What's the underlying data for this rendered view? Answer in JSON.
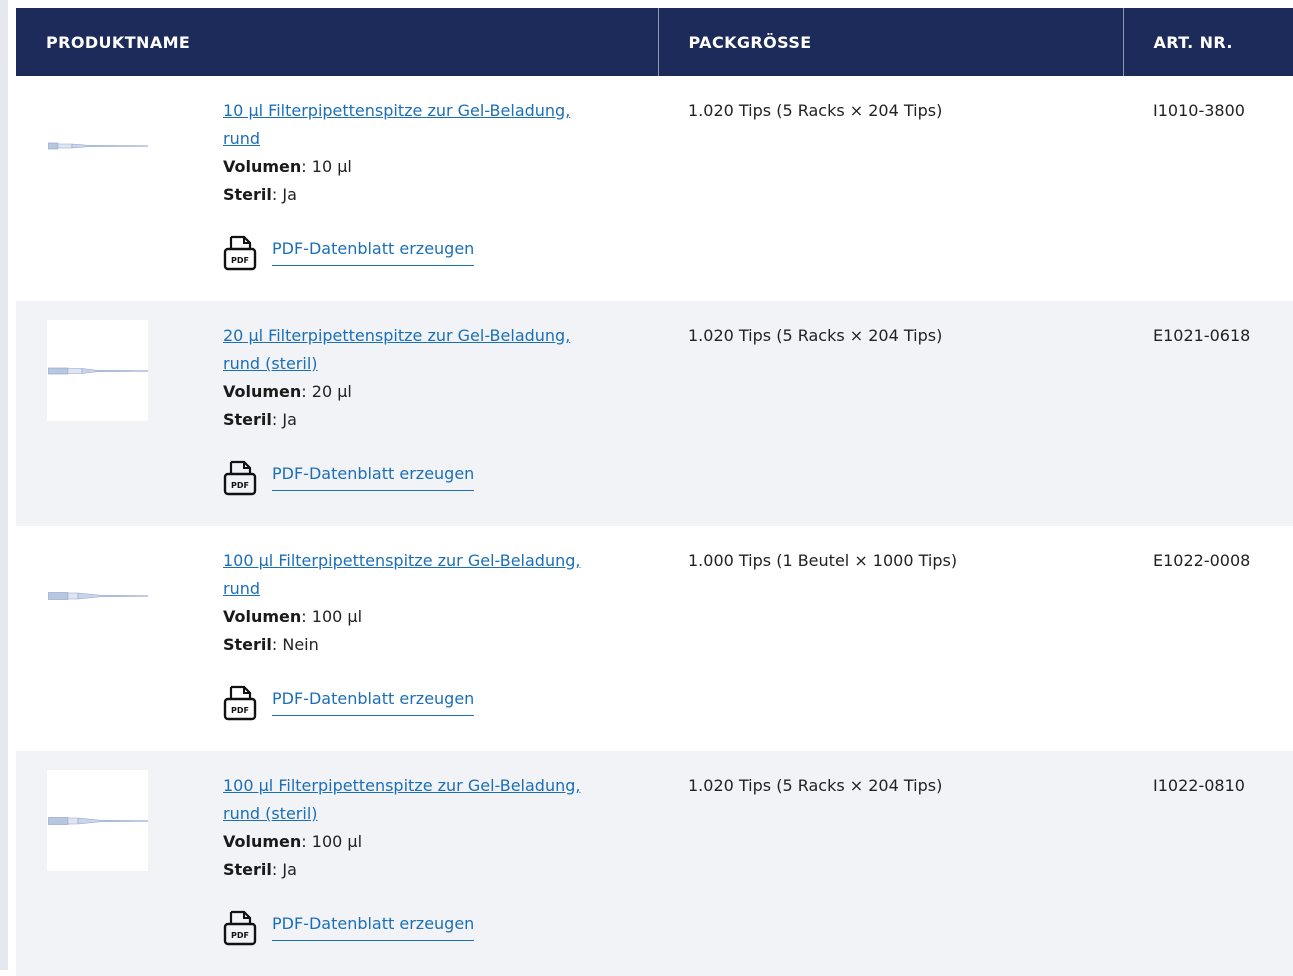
{
  "header": {
    "col_name": "PRODUKTNAME",
    "col_pack": "PACKGRÖSSE",
    "col_art": "ART. NR."
  },
  "colors": {
    "header_bg": "#1c2b5a",
    "link": "#1b6fb8",
    "alt_row": "#f2f3f6"
  },
  "rows": [
    {
      "title_line1": "10 µl Filterpipettenspitze zur Gel-Beladung,",
      "title_line2": "rund",
      "vol_label": "Volumen",
      "vol_value": ": 10 µl",
      "steril_label": "Steril",
      "steril_value": ": Ja",
      "pdf_label": "PDF-Datenblatt erzeugen",
      "pack": "1.020 Tips (5 Racks × 204 Tips)",
      "art": "I1010-3800",
      "icon": "pipette-tip-icon"
    },
    {
      "title_line1": "20 µl Filterpipettenspitze zur Gel-Beladung,",
      "title_line2": "rund (steril)",
      "vol_label": "Volumen",
      "vol_value": ": 20 µl",
      "steril_label": "Steril",
      "steril_value": ": Ja",
      "pdf_label": "PDF-Datenblatt erzeugen",
      "pack": "1.020 Tips (5 Racks × 204 Tips)",
      "art": "E1021-0618",
      "icon": "pipette-tip-icon"
    },
    {
      "title_line1": "100 µl Filterpipettenspitze zur Gel-Beladung,",
      "title_line2": "rund",
      "vol_label": "Volumen",
      "vol_value": ": 100 µl",
      "steril_label": "Steril",
      "steril_value": ": Nein",
      "pdf_label": "PDF-Datenblatt erzeugen",
      "pack": "1.000 Tips (1 Beutel × 1000 Tips)",
      "art": "E1022-0008",
      "icon": "pipette-tip-icon"
    },
    {
      "title_line1": "100 µl Filterpipettenspitze zur Gel-Beladung,",
      "title_line2": "rund (steril)",
      "vol_label": "Volumen",
      "vol_value": ": 100 µl",
      "steril_label": "Steril",
      "steril_value": ": Ja",
      "pdf_label": "PDF-Datenblatt erzeugen",
      "pack": "1.020 Tips (5 Racks × 204 Tips)",
      "art": "I1022-0810",
      "icon": "pipette-tip-icon"
    }
  ]
}
